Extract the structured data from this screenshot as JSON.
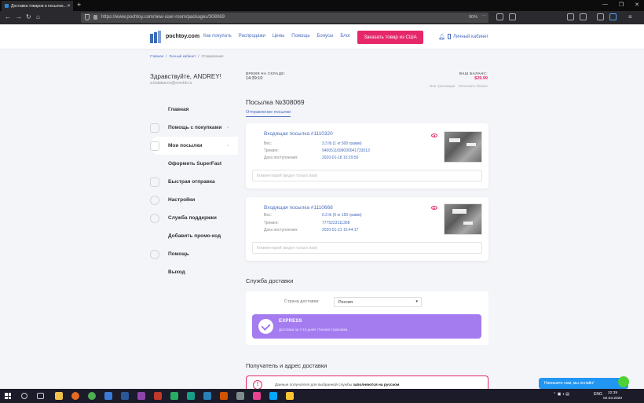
{
  "browser": {
    "tab_title": "Доставка товаров и посылок...",
    "url": "https://www.pochtoy.com/new-user-room/packages/308069",
    "zoom": "90%"
  },
  "header": {
    "logo": "pochtoy.com",
    "nav": [
      "Как покупать",
      "Распродажи",
      "Цены",
      "Помощь",
      "Бонусы",
      "Блог"
    ],
    "order_button": "Заказать товар из США",
    "cabinet": "Личный кабинет"
  },
  "breadcrumb": {
    "items": [
      "Главная",
      "Личный кабинет",
      "Отправления"
    ],
    "sep": "/"
  },
  "user": {
    "greeting": "Здравствуйте, ANDREY!",
    "email": "a.balabanov@nnrcbb.ru"
  },
  "sidebar": {
    "items": [
      {
        "label": "Главная"
      },
      {
        "label": "Помощь с покупками"
      },
      {
        "label": "Мои посылки"
      },
      {
        "label": "Оформить SuperFast"
      },
      {
        "label": "Быстрая отправка"
      },
      {
        "label": "Настройки"
      },
      {
        "label": "Служба поддержки"
      },
      {
        "label": "Добавить промо-код"
      },
      {
        "label": "Помощь"
      },
      {
        "label": "Выход"
      }
    ]
  },
  "stock": {
    "label": "ВРЕМЯ НА СКЛАДЕ:",
    "time": "14:39:10"
  },
  "balance": {
    "label": "ВАШ БАЛАНС:",
    "value": "$29.99",
    "link_transactions": "Мои транзакции",
    "link_topup": "Пополнить баланс"
  },
  "parcel": {
    "title": "Посылка №308069",
    "tab": "Отправление посылки"
  },
  "packages": [
    {
      "title": "Входящая посылка #1110320",
      "weight_label": "Вес:",
      "weight": "3.3 lb (1 кг 500 грамм)",
      "tracking_label": "Трекинг:",
      "tracking": "9400511699000041733013",
      "date_label": "Дата поступления:",
      "date": "2020-01-18 15:29:50",
      "comment_placeholder": "Комментарий (виден только вам)"
    },
    {
      "title": "Входящая посылка #1110668",
      "weight_label": "Вес:",
      "weight": "0.3 lb (0 кг 150 грамм)",
      "tracking_label": "Трекинг:",
      "tracking": "7775223111368",
      "date_label": "Дата поступления:",
      "date": "2020-01-21 15:44:17",
      "comment_placeholder": "Комментарий (виден только вам)"
    }
  ],
  "delivery": {
    "title": "Служба доставки",
    "country_label": "Страна доставки:",
    "country": "Россия",
    "service_name": "EXPRESS",
    "service_desc": "Доставка за 7-16 дней. Полная страховка."
  },
  "recipient": {
    "title": "Получатель и адрес доставки",
    "warning_prefix": "Данные получателя для выбранной службы",
    "warning_bold": "заполняются на русском"
  },
  "chat": {
    "text": "Напишите нам, мы онлайн!"
  },
  "taskbar": {
    "lang": "ENG",
    "time": "22:39",
    "date": "02.03.2020"
  },
  "colors": {
    "accent": "#e6276a",
    "link": "#4a6fc0",
    "express": "#a57cf0",
    "chat": "#2196f3"
  }
}
